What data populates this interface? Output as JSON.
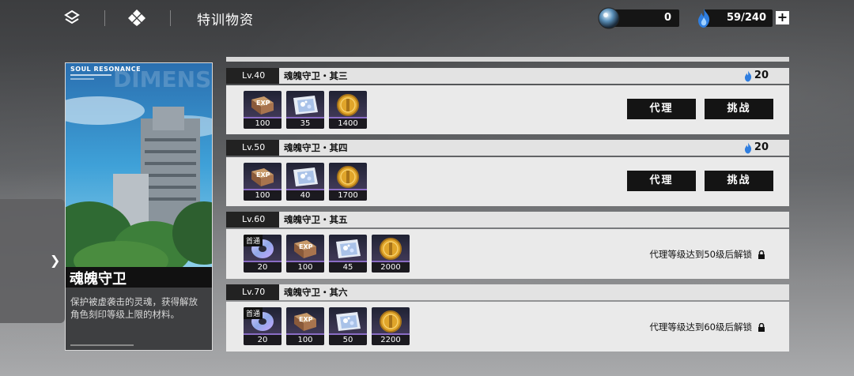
{
  "header": {
    "title": "特训物资",
    "currency": {
      "value": "0",
      "icon": "orb-icon"
    },
    "stamina": {
      "value": "59/240",
      "icon": "blue-flame-icon"
    },
    "add_label": "+"
  },
  "card": {
    "brand": "SOUL RESONANCE",
    "watermark": "DIMENSION",
    "name": "魂魄守卫",
    "description": "保护被虚袭击的灵魂，获得解放角色刻印等级上限的材料。"
  },
  "stages": [
    {
      "level": "Lv.40",
      "name": "魂魄守卫・其三",
      "cost": "20",
      "rewards": [
        {
          "icon": "exp-book-icon",
          "count": "100",
          "first_clear": false
        },
        {
          "icon": "crystal-map-icon",
          "count": "35",
          "first_clear": false
        },
        {
          "icon": "gold-coin-icon",
          "count": "1400",
          "first_clear": false
        }
      ],
      "buttons": {
        "proxy": "代理",
        "challenge": "挑战"
      },
      "lock_text": ""
    },
    {
      "level": "Lv.50",
      "name": "魂魄守卫・其四",
      "cost": "20",
      "rewards": [
        {
          "icon": "exp-book-icon",
          "count": "100",
          "first_clear": false
        },
        {
          "icon": "crystal-map-icon",
          "count": "40",
          "first_clear": false
        },
        {
          "icon": "gold-coin-icon",
          "count": "1700",
          "first_clear": false
        }
      ],
      "buttons": {
        "proxy": "代理",
        "challenge": "挑战"
      },
      "lock_text": ""
    },
    {
      "level": "Lv.60",
      "name": "魂魄守卫・其五",
      "cost": "",
      "first_clear_label": "首通",
      "rewards": [
        {
          "icon": "ring-disc-icon",
          "count": "20",
          "first_clear": true
        },
        {
          "icon": "exp-book-icon",
          "count": "100",
          "first_clear": false
        },
        {
          "icon": "crystal-map-icon",
          "count": "45",
          "first_clear": false
        },
        {
          "icon": "gold-coin-icon",
          "count": "2000",
          "first_clear": false
        }
      ],
      "lock_text": "代理等级达到50级后解锁"
    },
    {
      "level": "Lv.70",
      "name": "魂魄守卫・其六",
      "cost": "",
      "first_clear_label": "首通",
      "rewards": [
        {
          "icon": "ring-disc-icon",
          "count": "20",
          "first_clear": true
        },
        {
          "icon": "exp-book-icon",
          "count": "100",
          "first_clear": false
        },
        {
          "icon": "crystal-map-icon",
          "count": "50",
          "first_clear": false
        },
        {
          "icon": "gold-coin-icon",
          "count": "2200",
          "first_clear": false
        }
      ],
      "lock_text": "代理等级达到60级后解锁"
    }
  ]
}
